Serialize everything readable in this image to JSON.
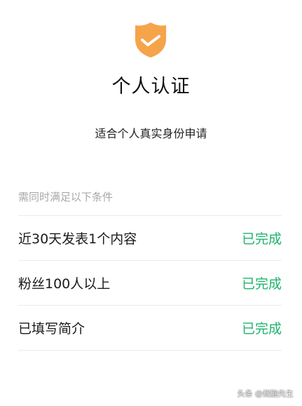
{
  "header": {
    "icon": "shield-check-icon",
    "title": "个人认证",
    "subtitle": "适合个人真实身份申请"
  },
  "requirements": {
    "hint": "需同时满足以下条件",
    "items": [
      {
        "label": "近30天发表1个内容",
        "status": "已完成"
      },
      {
        "label": "粉丝100人以上",
        "status": "已完成"
      },
      {
        "label": "已填写简介",
        "status": "已完成"
      }
    ]
  },
  "watermark": "头条 @烧脑先生",
  "colors": {
    "shield": "#f5a44a",
    "status_done": "#1db46b",
    "hint_text": "#a8a8a8",
    "divider": "#ececec"
  }
}
